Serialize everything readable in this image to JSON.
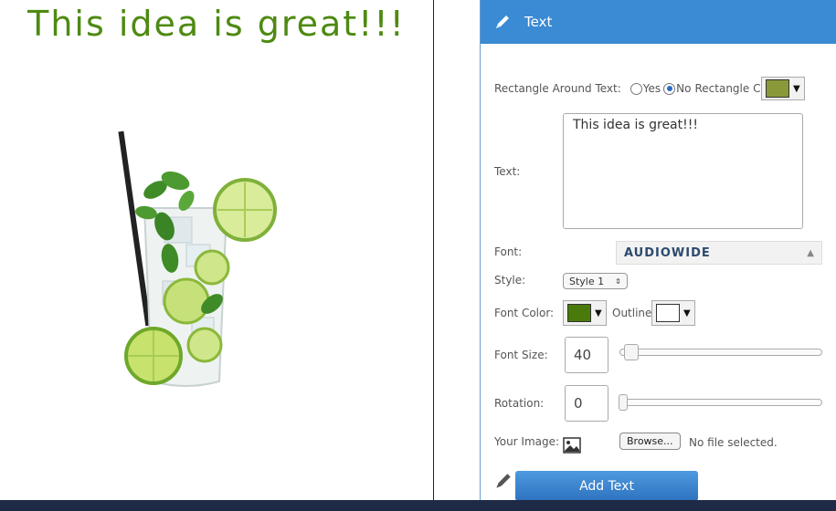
{
  "canvas": {
    "headline": "This idea is great!!!",
    "headline_color": "#4e8a12"
  },
  "panel": {
    "header_title": "Text",
    "header_icon": "pencil-icon",
    "rectangle": {
      "label": "Rectangle Around Text:",
      "yes_label": "Yes",
      "no_label": "No",
      "selected": "No",
      "color_label": "Rectangle Color:",
      "color": "#8a9a3a"
    },
    "text": {
      "label": "Text:",
      "value": "This idea is great!!!"
    },
    "font": {
      "label": "Font:",
      "value": "AUDIOWIDE"
    },
    "style": {
      "label": "Style:",
      "value": "Style 1"
    },
    "font_color": {
      "label": "Font Color:",
      "color": "#4a7a0c"
    },
    "outline": {
      "label": "Outline:",
      "color": "#ffffff"
    },
    "font_size": {
      "label": "Font Size:",
      "value": "40",
      "slider_fraction": 0.05
    },
    "rotation": {
      "label": "Rotation:",
      "value": "0",
      "slider_fraction": 0.0
    },
    "image": {
      "label": "Your Image:",
      "browse_label": "Browse...",
      "status": "No file selected."
    },
    "add_button_label": "Add Text"
  }
}
